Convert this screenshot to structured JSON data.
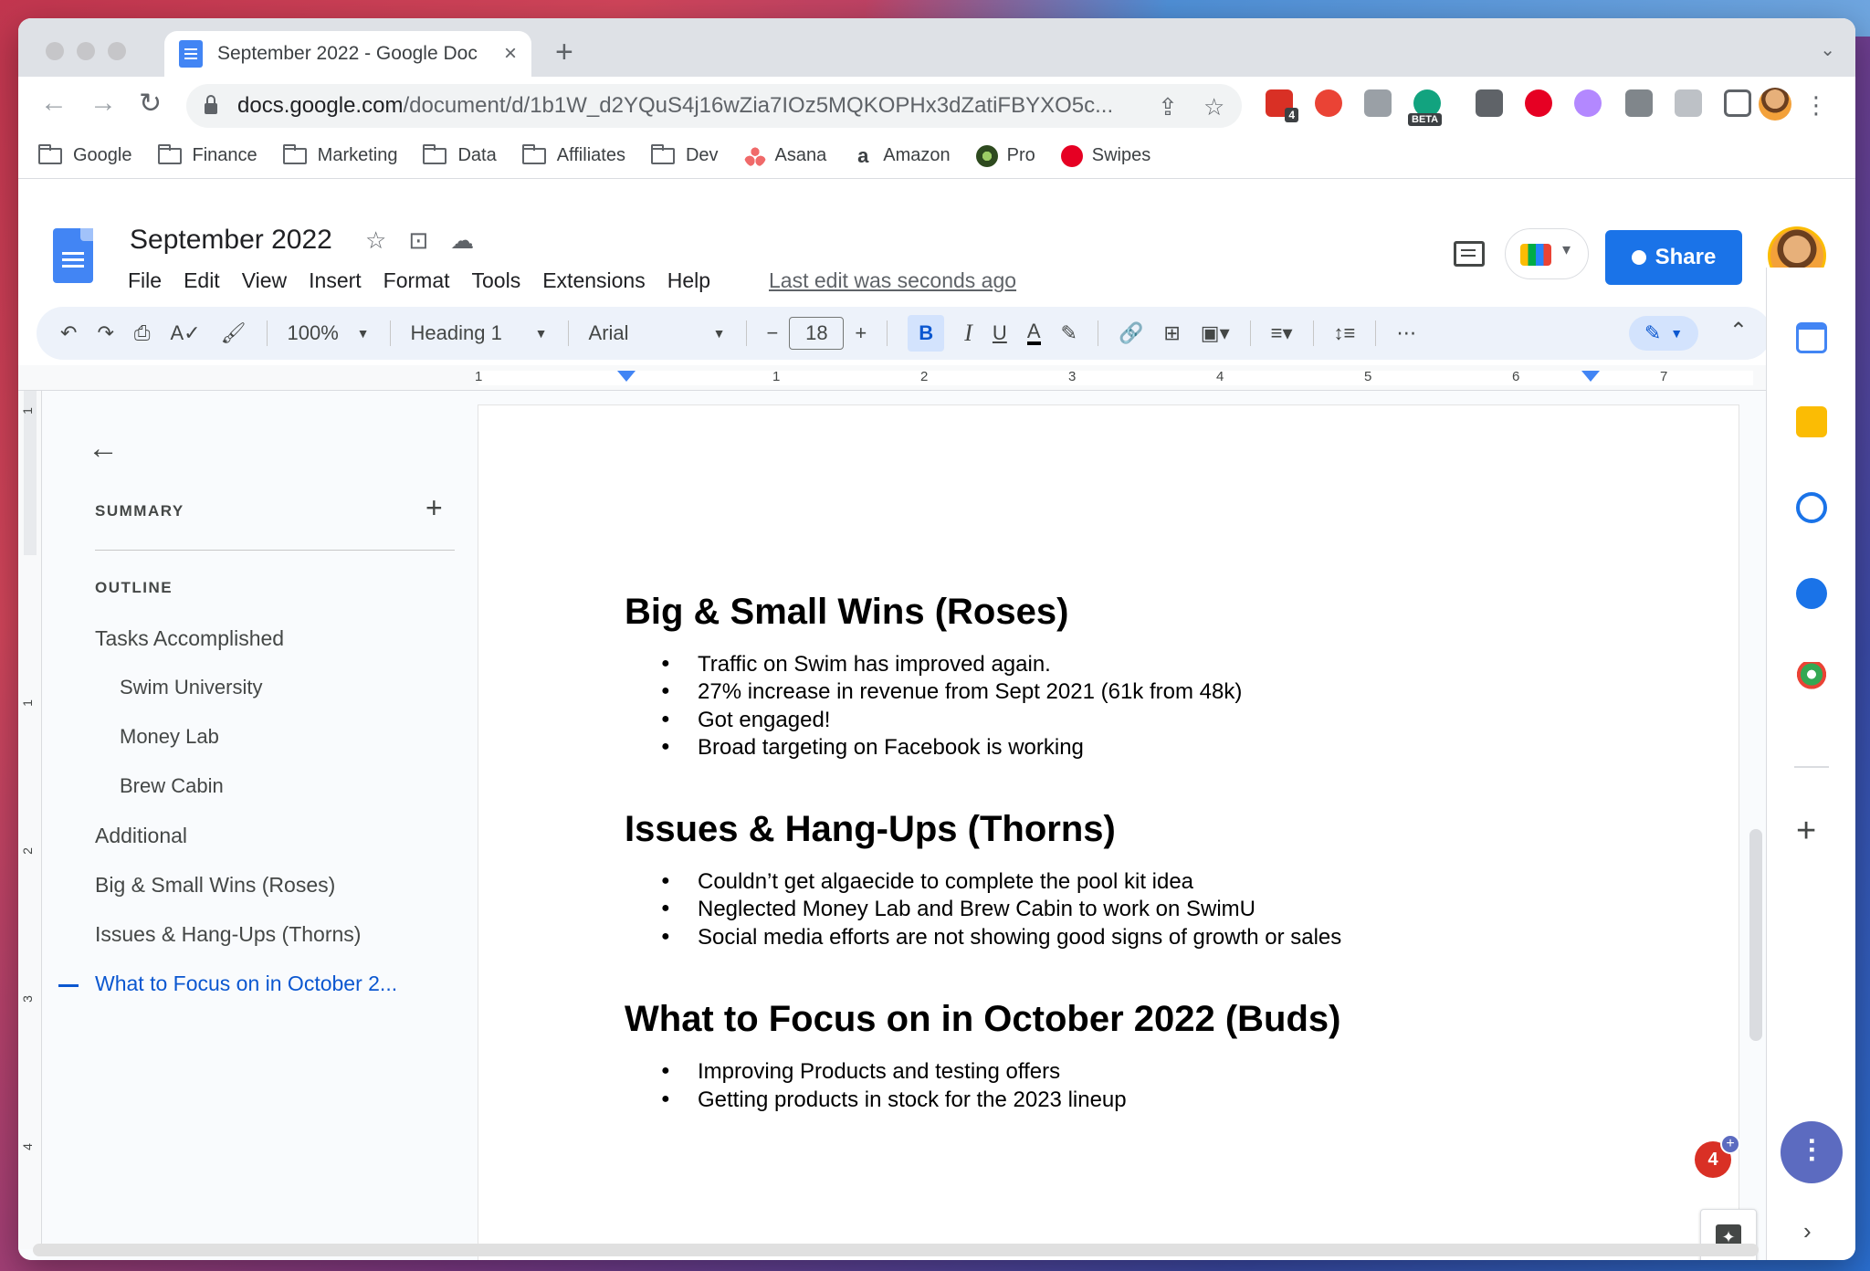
{
  "browser": {
    "tab_title": "September 2022 - Google Doc",
    "tab_close": "×",
    "new_tab": "+",
    "url_host": "docs.google.com",
    "url_path": "/document/d/1b1W_d2YQuS4j16wZia7IOz5MQKOPHx3dZatiFBYXO5c...",
    "ext_badge": "4",
    "ext_beta": "BETA"
  },
  "bookmarks": [
    {
      "label": "Google",
      "icon": "folder-icon"
    },
    {
      "label": "Finance",
      "icon": "folder-icon"
    },
    {
      "label": "Marketing",
      "icon": "folder-icon"
    },
    {
      "label": "Data",
      "icon": "folder-icon"
    },
    {
      "label": "Affiliates",
      "icon": "folder-icon"
    },
    {
      "label": "Dev",
      "icon": "folder-icon"
    },
    {
      "label": "Asana",
      "icon": "asana-icon",
      "color": "#f06a6a"
    },
    {
      "label": "Amazon",
      "icon": "amazon-icon",
      "color": "#000000"
    },
    {
      "label": "Pro",
      "icon": "pro-icon",
      "color": "#4a7d3a"
    },
    {
      "label": "Swipes",
      "icon": "pinterest-icon",
      "color": "#e60023"
    }
  ],
  "docs": {
    "title": "September 2022",
    "menu": [
      "File",
      "Edit",
      "View",
      "Insert",
      "Format",
      "Tools",
      "Extensions",
      "Help"
    ],
    "last_edit": "Last edit was seconds ago",
    "share_label": "Share"
  },
  "toolbar": {
    "zoom": "100%",
    "style": "Heading 1",
    "font": "Arial",
    "font_size": "18",
    "minus": "−",
    "plus": "+",
    "bold": "B",
    "italic": "I",
    "underline": "U",
    "text_color": "A",
    "more": "⋯"
  },
  "ruler": {
    "labels": [
      "1",
      "1",
      "2",
      "3",
      "4",
      "5",
      "6",
      "7"
    ],
    "vlabels": [
      "1",
      "1",
      "2",
      "3",
      "4"
    ]
  },
  "outline": {
    "summary_label": "SUMMARY",
    "outline_label": "OUTLINE",
    "items": [
      {
        "label": "Tasks Accomplished",
        "level": 1
      },
      {
        "label": "Swim University",
        "level": 2
      },
      {
        "label": "Money Lab",
        "level": 2
      },
      {
        "label": "Brew Cabin",
        "level": 2
      },
      {
        "label": "Additional",
        "level": 1
      },
      {
        "label": "Big & Small Wins (Roses)",
        "level": 1
      },
      {
        "label": "Issues & Hang-Ups (Thorns)",
        "level": 1
      },
      {
        "label": "What to Focus on in October 2...",
        "level": 1,
        "active": true
      }
    ]
  },
  "document": {
    "sections": [
      {
        "heading": "Big & Small Wins (Roses)",
        "bullets": [
          "Traffic on Swim has improved again.",
          "27% increase in revenue from Sept 2021 (61k from 48k)",
          "Got engaged!",
          "Broad targeting on Facebook is working"
        ]
      },
      {
        "heading": "Issues & Hang-Ups (Thorns)",
        "bullets": [
          "Couldn’t get algaecide to complete the pool kit idea",
          "Neglected Money Lab and Brew Cabin to work on SwimU",
          "Social media efforts are not showing good signs of growth or sales"
        ]
      },
      {
        "heading": "What to Focus on in October 2022 (Buds)",
        "bullets": [
          "Improving Products and testing offers",
          "Getting products in stock for the 2023 lineup"
        ]
      }
    ]
  },
  "widgets": {
    "badge_count": "4",
    "badge_plus": "+",
    "side_plus": "+"
  },
  "colors": {
    "accent": "#1a73e8",
    "active_outline": "#0b57d0",
    "toolbar_bg": "#edf2fa"
  }
}
